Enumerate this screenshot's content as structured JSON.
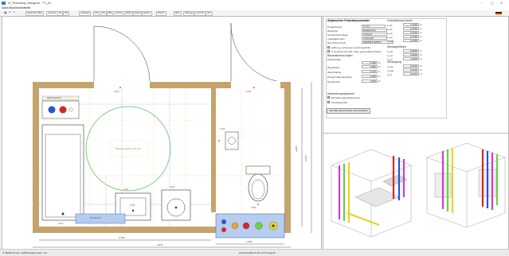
{
  "window": {
    "title": "LT_Plumbing_Designer - T1_01",
    "controls": [
      "–",
      "□",
      "✕"
    ]
  },
  "menu": [
    "Datei",
    "Bearbeiten",
    "Hilfe"
  ],
  "toolbar": [
    {
      "label": "Speichern/Neu"
    },
    {
      "label": "Löschen"
    },
    {
      "label": "Sh"
    },
    {
      "label": "WC"
    },
    {
      "label": "Auflösen"
    },
    {
      "label": "WT"
    },
    {
      "label": "DU"
    },
    {
      "label": "BW"
    },
    {
      "label": "Urinal"
    },
    {
      "label": "Bidet"
    },
    {
      "label": "Spüle"
    },
    {
      "label": "Siphon"
    },
    {
      "label": "Export"
    },
    {
      "label": "Rohr"
    },
    {
      "label": "Stränge"
    },
    {
      "label": "Ansicht"
    },
    {
      "label": "Info"
    }
  ],
  "toolbar_icons": [
    "save-icon",
    "undo-icon",
    "redo-icon",
    "zoom-in-icon",
    "zoom-out-icon",
    "settings-icon",
    "flag-de-icon"
  ],
  "properties": {
    "general_title": "Allgemeine Projektparameter",
    "project_name_label": "Projektname",
    "project_name_value": "T1_01",
    "room_type_label": "Raumtyp",
    "room_type_value": "Nassbereich",
    "wall_label": "Vorwandmontage",
    "wall_value": "Vorwand",
    "installation_label": "Installationsart",
    "installation_value": "Unterputz",
    "standard_label": "Norm/Vorschrift",
    "standard_value": "ÖNORM B 5008-2",
    "cb_ventilation_label": "Lüftung vorhanden (ventil gefüllt)",
    "cb_ventilation_checked": true,
    "cb_wc_label": "in Schacht der WC- bzw. ganze Raumbreite",
    "cb_wc_checked": true,
    "room_dims_title": "Raumabmessungen",
    "room_width_label": "Raumbreite",
    "room_width_value": "2,450",
    "room_width_unit": "m",
    "room_length_label": "Raumtiefe",
    "room_length_value": "2,880",
    "room_length_unit": "m",
    "wall_thickness_label": "Wandstärke",
    "wall_thickness_value": "0,120",
    "wall_thickness_unit": "m",
    "ceiling_label": "Fertig-Fußbodenhöhe",
    "ceiling_value": "0,000",
    "ceiling_unit": "m",
    "storey_label": "Raumhöhe",
    "storey_value": "2,600",
    "storey_unit": "m",
    "design_options_title": "Darstellungsoptionen",
    "cb_dims_label": "Bemaßungen/Rasterlinie",
    "cb_dims_checked": true,
    "cb_fixtures_label": "Sanitärgeräte",
    "cb_fixtures_checked": true,
    "apply_button": "Alle Wandanschlüsse zurücksetzen",
    "install_title": "Installationsschacht",
    "install_rows": [
      {
        "label": "L_sh",
        "value": "1,0000",
        "unit": "m"
      },
      {
        "label": "b_sh",
        "value": "0,2500",
        "unit": "m"
      },
      {
        "label": "h_sh",
        "value": "0,2500",
        "unit": "m"
      },
      {
        "label": "t_vw",
        "value": "0,1500",
        "unit": "m"
      },
      {
        "label": "d_vw",
        "value": "0,2000",
        "unit": "m"
      }
    ],
    "mount_title": "Montagehöhen",
    "mount_rows": [
      {
        "label": "h_wt",
        "value": "0,8500",
        "unit": "m"
      },
      {
        "label": "h_wc",
        "value": "0,4600",
        "unit": "m"
      },
      {
        "label": "h_du",
        "value": "1,0500",
        "unit": "m"
      }
    ],
    "pipes_title": "Versorgung",
    "pipes_rows": [
      {
        "label": "d_kw",
        "value": "0,0200",
        "unit": "m"
      },
      {
        "label": "d_ww",
        "value": "0,0200",
        "unit": "m"
      },
      {
        "label": "d_zr",
        "value": "0,0150",
        "unit": "m"
      }
    ]
  },
  "plan": {
    "label_top_fixture": "Waschmaschine",
    "label_center": "Bewegungsfläche Ø 150",
    "label_blue_bottom": "BS 40/1.50",
    "dim_bottom_inner": "2,340",
    "dim_bottom_outer": "2,670",
    "dim_bottom_right": "1,300",
    "dim_right_a": "2,460",
    "dim_right_b": "2,570",
    "small_dims": [
      "0,600",
      "0,600",
      "0,250",
      "0,600",
      "0,450",
      "0,500",
      "0,600",
      "0,300"
    ]
  },
  "status": {
    "left": "© BOSS Gruss, Softwaregenosse, 1.0",
    "center": "www.haustechnik-rechnung.at"
  },
  "colors": {
    "wall": "#c4a46c",
    "blue_fill": "#b6cdee",
    "green_circle": "#60c060",
    "cold_water": "#2a54d0",
    "hot_water": "#d22a2a",
    "pipe_magenta": "#d23cc8",
    "pipe_green": "#6ad23a",
    "pipe_yellow": "#e6d22a"
  }
}
